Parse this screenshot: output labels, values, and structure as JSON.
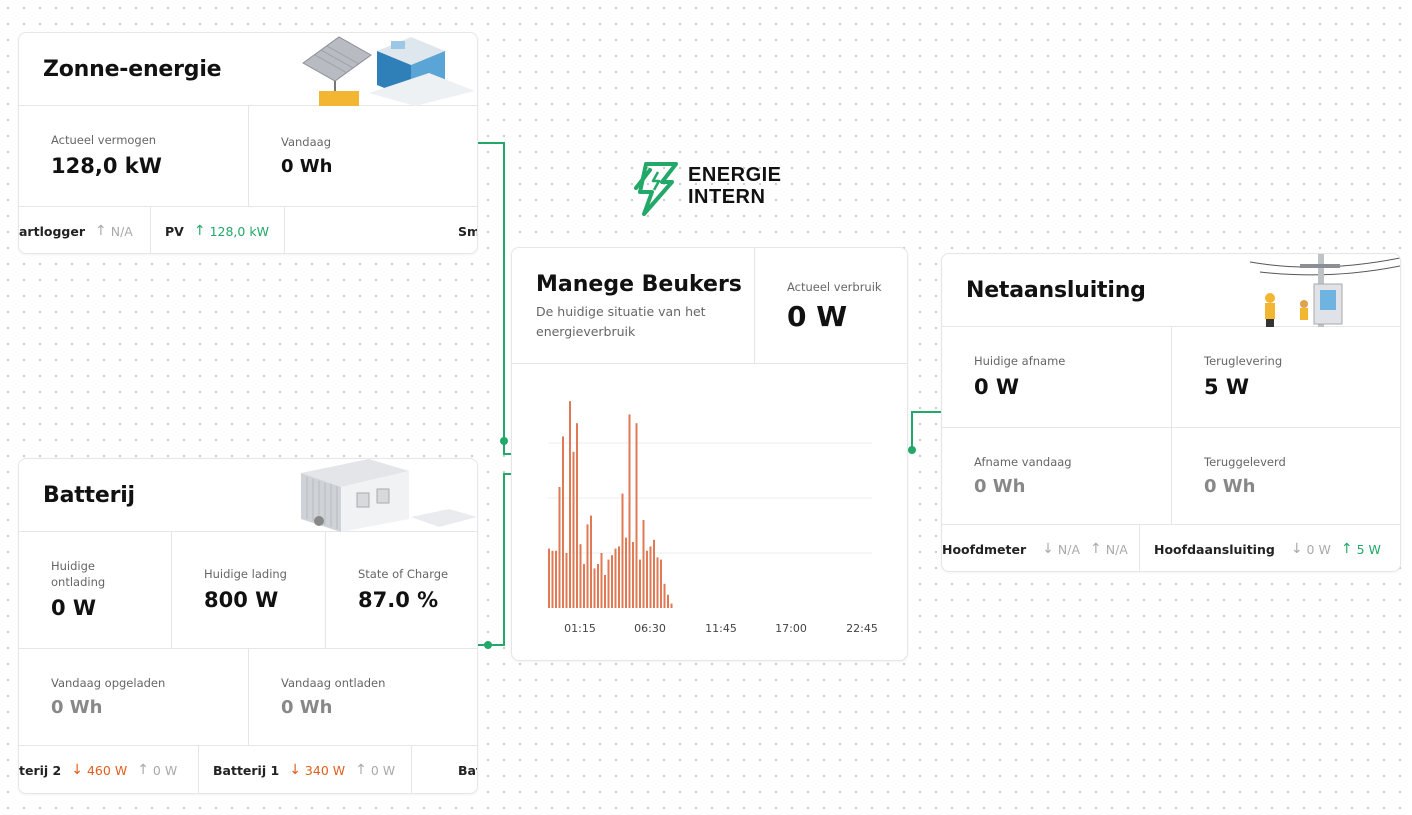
{
  "brand": {
    "line1": "ENERGIE",
    "line2": "INTERN",
    "color": "#22a868"
  },
  "solar": {
    "title": "Zonne-energie",
    "stats": [
      {
        "label": "Actueel vermogen",
        "value": "128,0 kW"
      },
      {
        "label": "Vandaag",
        "value": "0 Wh"
      }
    ],
    "strip": [
      {
        "name": "artlogger",
        "value": "N/A",
        "dir": "up-grey"
      },
      {
        "name": "PV",
        "value": "128,0 kW",
        "dir": "up-green"
      },
      {
        "name": "Sm",
        "value": "",
        "dir": ""
      }
    ]
  },
  "battery": {
    "title": "Batterij",
    "stats_top": [
      {
        "label": "Huidige ontlading",
        "value": "0 W"
      },
      {
        "label": "Huidige lading",
        "value": "800 W"
      },
      {
        "label": "State of Charge",
        "value": "87.0 %"
      }
    ],
    "stats_bottom": [
      {
        "label": "Vandaag opgeladen",
        "value": "0 Wh"
      },
      {
        "label": "Vandaag ontladen",
        "value": "0 Wh"
      }
    ],
    "strip": [
      {
        "name": "terij 2",
        "down": "460 W",
        "up": "0 W"
      },
      {
        "name": "Batterij 1",
        "down": "340 W",
        "up": "0 W"
      },
      {
        "name": "Bat",
        "down": "",
        "up": ""
      }
    ]
  },
  "center": {
    "title": "Manege Beukers",
    "subtitle": "De huidige situatie van het energieverbruik",
    "usage_label": "Actueel verbruik",
    "usage_value": "0 W"
  },
  "grid": {
    "title": "Netaansluiting",
    "stats": [
      {
        "label": "Huidige afname",
        "value": "0 W"
      },
      {
        "label": "Teruglevering",
        "value": "5 W"
      },
      {
        "label": "Afname vandaag",
        "value": "0 Wh"
      },
      {
        "label": "Teruggeleverd",
        "value": "0 Wh"
      }
    ],
    "strip": [
      {
        "name": "Hoofdmeter",
        "down": "N/A",
        "up": "N/A",
        "upColor": "up-grey"
      },
      {
        "name": "Hoofdaansluiting",
        "down": "0 W",
        "up": "5 W",
        "upColor": "up-green"
      }
    ]
  },
  "chart_data": {
    "type": "bar",
    "color": "#e07a55",
    "x_tick_labels": [
      "01:15",
      "06:30",
      "11:45",
      "17:00",
      "22:45"
    ],
    "values": [
      0.27,
      0.26,
      0.26,
      0.55,
      0.78,
      0.25,
      0.94,
      0.71,
      0.84,
      0.29,
      0.2,
      0.38,
      0.42,
      0.18,
      0.2,
      0.25,
      0.15,
      0.22,
      0.24,
      0.27,
      0.28,
      0.52,
      0.32,
      0.88,
      0.3,
      0.84,
      0.22,
      0.4,
      0.26,
      0.28,
      0.31,
      0.23,
      0.22,
      0.11,
      0.06,
      0.02
    ],
    "ylim": [
      0,
      1
    ],
    "grid": true
  }
}
